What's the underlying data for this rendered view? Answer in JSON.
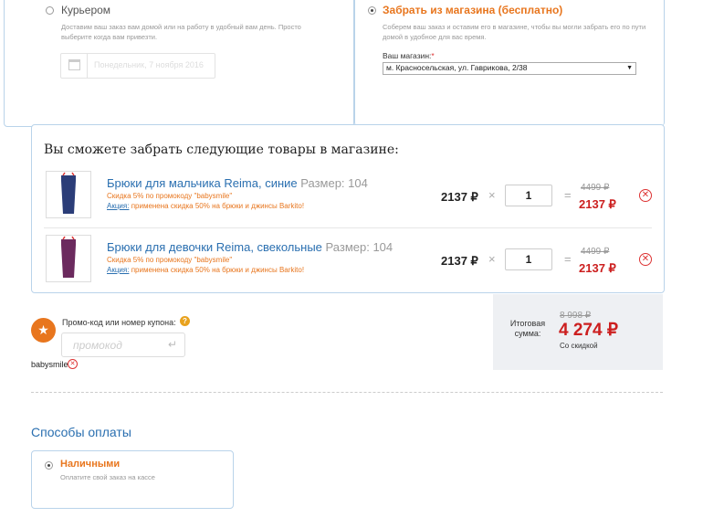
{
  "delivery": {
    "courier": {
      "label": "Курьером",
      "description": "Доставим ваш заказ вам домой или на работу в удобный вам день. Просто выберите когда вам привезти.",
      "date_placeholder": "Понедельник, 7 ноября 2016"
    },
    "pickup": {
      "label": "Забрать из магазина (бесплатно)",
      "description": "Соберем ваш заказ и оставим его в магазине, чтобы вы могли забрать его по пути домой в удобное для вас время.",
      "store_label": "Ваш магазин:",
      "required_mark": "*",
      "store_value": "м. Красносельская, ул. Гаврикова, 2/38"
    }
  },
  "items_section": {
    "heading": "Вы сможете забрать следующие товары в магазине:",
    "items": [
      {
        "title": "Брюки для мальчика Reima, синие",
        "size_label": "Размер: 104",
        "promo": "Скидка 5% по промокоду \"babysmile\"",
        "action_link": "Акция:",
        "action_text": "применена скидка 50% на брюки и джинсы Barkito!",
        "unit_price": "2137 ₽",
        "quantity": "1",
        "old_price": "4499 ₽",
        "total_price": "2137 ₽",
        "thumb_color": "#2b3d78"
      },
      {
        "title": "Брюки для девочки Reima, свекольные",
        "size_label": "Размер: 104",
        "promo": "Скидка 5% по промокоду \"babysmile\"",
        "action_link": "Акция:",
        "action_text": "применена скидка 50% на брюки и джинсы Barkito!",
        "unit_price": "2137 ₽",
        "quantity": "1",
        "old_price": "4499 ₽",
        "total_price": "2137 ₽",
        "thumb_color": "#6b2a5e"
      }
    ],
    "multiply_sign": "×",
    "equals_sign": "="
  },
  "promo": {
    "label": "Промо-код или номер купона:",
    "help": "?",
    "placeholder": "промокод",
    "applied_code": "babysmile",
    "star": "★",
    "arrow": "↵"
  },
  "summary": {
    "label_line1": "Итоговая",
    "label_line2": "сумма:",
    "old_total": "8 998 ₽",
    "total": "4 274 ₽",
    "note": "Со скидкой"
  },
  "payment": {
    "heading": "Способы оплаты",
    "option_label": "Наличными",
    "option_description": "Оплатите свой заказ на кассе"
  },
  "colors": {
    "accent_orange": "#e8761e",
    "price_red": "#cc1f1f",
    "link_blue": "#2a6fb0",
    "border_blue": "#b9d3ea"
  }
}
